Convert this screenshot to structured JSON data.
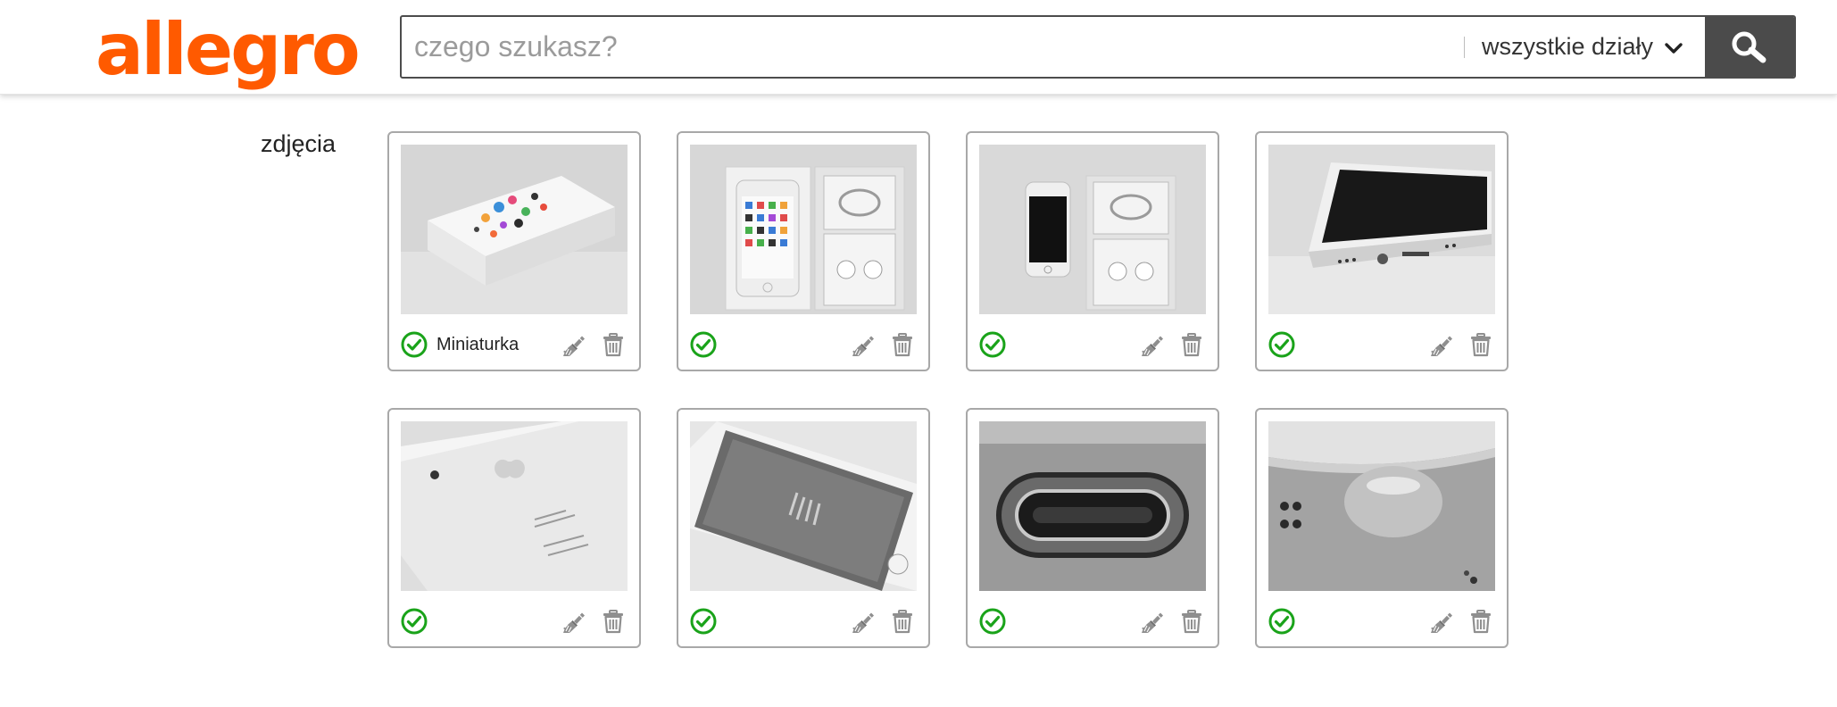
{
  "header": {
    "logo_text": "allegro",
    "search": {
      "placeholder": "czego szukasz?",
      "value": ""
    },
    "category_select": {
      "selected": "wszystkie działy"
    },
    "colors": {
      "brand": "#ff5a00",
      "search_button": "#4b4b4b",
      "check": "#1aa31a"
    }
  },
  "photos_section": {
    "label": "zdjęcia",
    "photos": [
      {
        "thumbnail_label": "Miniaturka",
        "depicts": "phone box"
      },
      {
        "thumbnail_label": "",
        "depicts": "box contents with phone and accessories"
      },
      {
        "thumbnail_label": "",
        "depicts": "phone with charger and earphones"
      },
      {
        "thumbnail_label": "",
        "depicts": "phone bottom view"
      },
      {
        "thumbnail_label": "",
        "depicts": "phone back"
      },
      {
        "thumbnail_label": "",
        "depicts": "phone screen hello"
      },
      {
        "thumbnail_label": "",
        "depicts": "charging port close-up"
      },
      {
        "thumbnail_label": "",
        "depicts": "edge scratch close-up"
      }
    ]
  }
}
